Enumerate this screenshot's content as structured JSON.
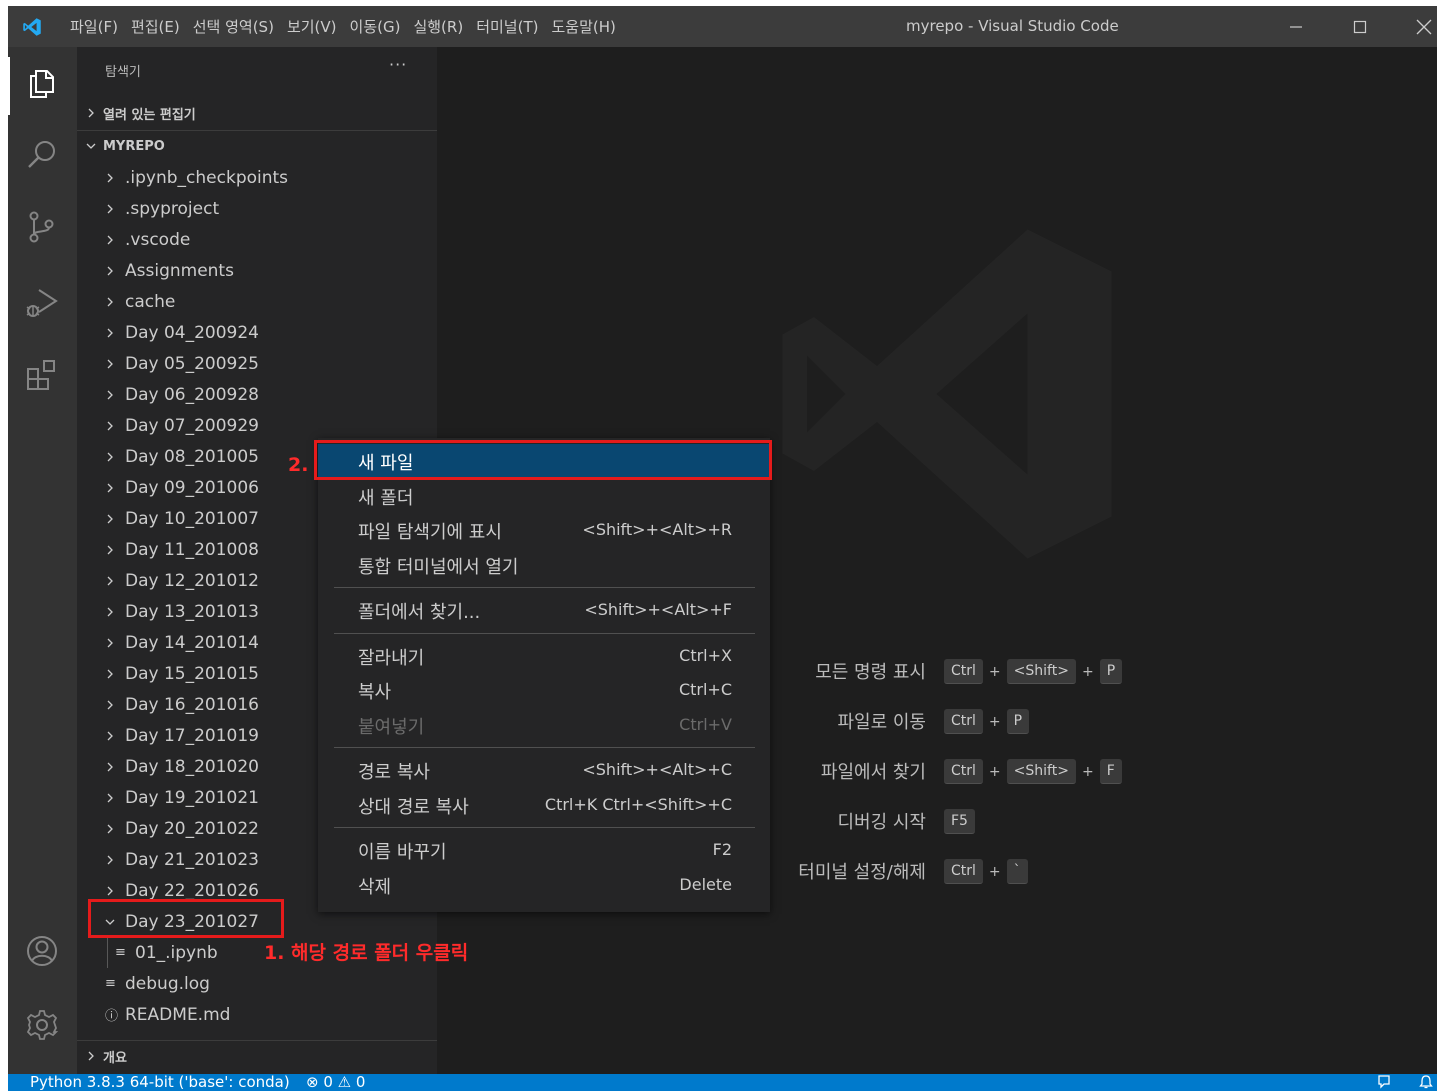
{
  "titlebar": {
    "menu": [
      "파일(F)",
      "편집(E)",
      "선택 영역(S)",
      "보기(V)",
      "이동(G)",
      "실행(R)",
      "터미널(T)",
      "도움말(H)"
    ],
    "window_title": "myrepo - Visual Studio Code",
    "minimize": "—",
    "maximize": "☐",
    "close": "✕"
  },
  "activitybar": {
    "icons": [
      "explorer-icon",
      "search-icon",
      "source-control-icon",
      "run-debug-icon",
      "extensions-icon",
      "account-icon",
      "settings-gear-icon"
    ]
  },
  "sidebar": {
    "title": "탐색기",
    "more": "···",
    "open_editors": "열려 있는 편집기",
    "workspace": "MYREPO",
    "outline": "개요",
    "items": [
      {
        "label": ".ipynb_checkpoints",
        "type": "folder"
      },
      {
        "label": ".spyproject",
        "type": "folder"
      },
      {
        "label": ".vscode",
        "type": "folder"
      },
      {
        "label": "Assignments",
        "type": "folder"
      },
      {
        "label": "cache",
        "type": "folder"
      },
      {
        "label": "Day 04_200924",
        "type": "folder"
      },
      {
        "label": "Day 05_200925",
        "type": "folder"
      },
      {
        "label": "Day 06_200928",
        "type": "folder"
      },
      {
        "label": "Day 07_200929",
        "type": "folder"
      },
      {
        "label": "Day 08_201005",
        "type": "folder"
      },
      {
        "label": "Day 09_201006",
        "type": "folder"
      },
      {
        "label": "Day 10_201007",
        "type": "folder"
      },
      {
        "label": "Day 11_201008",
        "type": "folder"
      },
      {
        "label": "Day 12_201012",
        "type": "folder"
      },
      {
        "label": "Day 13_201013",
        "type": "folder"
      },
      {
        "label": "Day 14_201014",
        "type": "folder"
      },
      {
        "label": "Day 15_201015",
        "type": "folder"
      },
      {
        "label": "Day 16_201016",
        "type": "folder"
      },
      {
        "label": "Day 17_201019",
        "type": "folder"
      },
      {
        "label": "Day 18_201020",
        "type": "folder"
      },
      {
        "label": "Day 19_201021",
        "type": "folder"
      },
      {
        "label": "Day 20_201022",
        "type": "folder"
      },
      {
        "label": "Day 21_201023",
        "type": "folder"
      },
      {
        "label": "Day 22_201026",
        "type": "folder"
      },
      {
        "label": "Day 23_201027",
        "type": "folder-open"
      },
      {
        "label": "01_.ipynb",
        "type": "file-nested"
      },
      {
        "label": "debug.log",
        "type": "file"
      },
      {
        "label": "README.md",
        "type": "info-file"
      }
    ]
  },
  "context_menu": {
    "groups": [
      [
        {
          "label": "새 파일",
          "key": "",
          "state": "selected"
        },
        {
          "label": "새 폴더",
          "key": "",
          "state": "normal"
        },
        {
          "label": "파일 탐색기에 표시",
          "key": "<Shift>+<Alt>+R",
          "state": "normal"
        },
        {
          "label": "통합 터미널에서 열기",
          "key": "",
          "state": "normal"
        }
      ],
      [
        {
          "label": "폴더에서 찾기...",
          "key": "<Shift>+<Alt>+F",
          "state": "normal"
        }
      ],
      [
        {
          "label": "잘라내기",
          "key": "Ctrl+X",
          "state": "normal"
        },
        {
          "label": "복사",
          "key": "Ctrl+C",
          "state": "normal"
        },
        {
          "label": "붙여넣기",
          "key": "Ctrl+V",
          "state": "disabled"
        }
      ],
      [
        {
          "label": "경로 복사",
          "key": "<Shift>+<Alt>+C",
          "state": "normal"
        },
        {
          "label": "상대 경로 복사",
          "key": "Ctrl+K Ctrl+<Shift>+C",
          "state": "normal"
        }
      ],
      [
        {
          "label": "이름 바꾸기",
          "key": "F2",
          "state": "normal"
        },
        {
          "label": "삭제",
          "key": "Delete",
          "state": "normal"
        }
      ]
    ]
  },
  "editor": {
    "shortcuts": [
      {
        "label": "모든 명령 표시",
        "keys": [
          "Ctrl",
          "<Shift>",
          "P"
        ]
      },
      {
        "label": "파일로 이동",
        "keys": [
          "Ctrl",
          "P"
        ]
      },
      {
        "label": "파일에서 찾기",
        "keys": [
          "Ctrl",
          "<Shift>",
          "F"
        ]
      },
      {
        "label": "디버깅 시작",
        "keys": [
          "F5"
        ]
      },
      {
        "label": "터미널 설정/해제",
        "keys": [
          "Ctrl",
          "`"
        ]
      }
    ]
  },
  "statusbar": {
    "python": "Python 3.8.3 64-bit ('base': conda)",
    "problems": "⊗ 0 ⚠ 0"
  },
  "annotations": {
    "step1": "1. 해당 경로 폴더 우클릭",
    "step2": "2."
  },
  "colors": {
    "annotation_red": "#e51b1b",
    "statusbar_blue": "#007acc",
    "menu_selection": "#094771",
    "vscode_logo_blue": "#23a9f2"
  }
}
